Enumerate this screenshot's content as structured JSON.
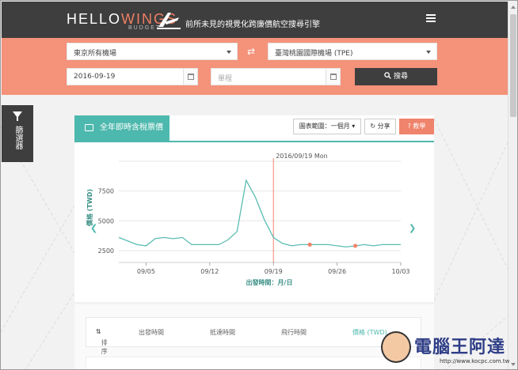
{
  "header": {
    "logo_hello": "HELLO",
    "logo_wings": "WINGS",
    "logo_budget": "BUDGET",
    "tagline": "前所未見的視覺化跨廉價航空搜尋引擎",
    "menu_icon": "hamburger-menu-icon"
  },
  "search": {
    "origin": "東京所有機場",
    "destination": "臺灣桃園國際機場 (TPE)",
    "swap_icon": "swap-arrows-icon",
    "depart_date": "2016-09-19",
    "return_placeholder": "單程",
    "button_label": "搜尋",
    "button_icon": "search-icon"
  },
  "filter_tab": {
    "label": "篩選器",
    "icon": "funnel-icon"
  },
  "panel": {
    "tab_label": "全年即時含稅票價",
    "tab_icon": "image-icon",
    "range_label": "圖表範圍：一個月",
    "share_label": "分享",
    "help_label": "教學"
  },
  "chart_data": {
    "type": "line",
    "x": [
      "09/02",
      "09/03",
      "09/04",
      "09/05",
      "09/06",
      "09/07",
      "09/08",
      "09/09",
      "09/10",
      "09/11",
      "09/12",
      "09/13",
      "09/14",
      "09/15",
      "09/16",
      "09/17",
      "09/18",
      "09/19",
      "09/20",
      "09/21",
      "09/22",
      "09/23",
      "09/24",
      "09/25",
      "09/26",
      "09/27",
      "09/28",
      "09/29",
      "09/30",
      "10/01",
      "10/02",
      "10/03"
    ],
    "y": [
      3600,
      3300,
      3000,
      2900,
      3500,
      3600,
      3500,
      3600,
      3000,
      3000,
      3000,
      3000,
      3400,
      4100,
      8400,
      7000,
      5100,
      3600,
      3100,
      2900,
      3000,
      3000,
      3000,
      3000,
      2900,
      2800,
      2900,
      3000,
      2900,
      3000,
      3000,
      3000
    ],
    "xtick_labels": [
      "09/05",
      "09/12",
      "09/19",
      "09/26",
      "10/03"
    ],
    "ytick_labels": [
      "2500",
      "5000",
      "7500"
    ],
    "ylim": [
      1500,
      10000
    ],
    "ylabel": "價格 (TWD)",
    "xlabel": "出發時間：月/日",
    "annotation": "2016/09/19 Mon",
    "marked_dates": [
      "09/23",
      "09/28"
    ],
    "grid": true,
    "colors": {
      "line": "#5bbdb3",
      "marker": "#f0836b",
      "cursor": "#f0836b"
    }
  },
  "results_header": {
    "sort": "排序",
    "depart": "出發時間",
    "arrive": "抵達時間",
    "duration": "飛行時間",
    "price": "價格 (TWD)"
  },
  "watermark": {
    "brand": "電腦王阿達",
    "url": "http://www.kocpc.com.tw"
  }
}
